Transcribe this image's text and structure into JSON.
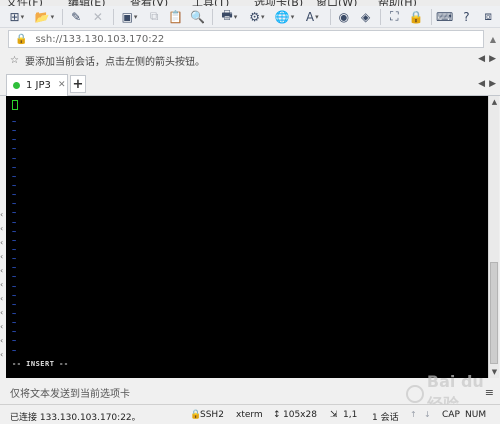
{
  "menubar": {
    "items": [
      "文件(F)",
      "编辑(E)",
      "查看(V)",
      "工具(T)",
      "选项卡(B)",
      "窗口(W)",
      "帮助(H)"
    ]
  },
  "toolbar": {
    "buttons": [
      {
        "icon": "new-session-icon",
        "glyph": "⊞",
        "dropdown": true
      },
      {
        "icon": "open-folder-icon",
        "glyph": "📂",
        "dropdown": true
      },
      {
        "icon": "link-icon",
        "glyph": "✎",
        "dropdown": false
      },
      {
        "icon": "disconnect-icon",
        "glyph": "✕",
        "dropdown": false,
        "disabled": true
      },
      {
        "icon": "new-window-icon",
        "glyph": "▣",
        "dropdown": true
      },
      {
        "icon": "copy-icon",
        "glyph": "⧉",
        "dropdown": false,
        "disabled": true
      },
      {
        "icon": "paste-icon",
        "glyph": "📋",
        "dropdown": false
      },
      {
        "icon": "find-icon",
        "glyph": "🔍",
        "dropdown": false
      },
      {
        "icon": "print-icon",
        "glyph": "🖶",
        "dropdown": true
      },
      {
        "icon": "properties-icon",
        "glyph": "⚙",
        "dropdown": true
      },
      {
        "icon": "globe-icon",
        "glyph": "🌐",
        "dropdown": true
      },
      {
        "icon": "font-icon",
        "glyph": "A",
        "dropdown": true
      },
      {
        "icon": "xshell-icon",
        "glyph": "◉",
        "dropdown": false
      },
      {
        "icon": "xftp-icon",
        "glyph": "◈",
        "dropdown": false
      },
      {
        "icon": "fullscreen-icon",
        "glyph": "⛶",
        "dropdown": false
      },
      {
        "icon": "lock-icon",
        "glyph": "🔒",
        "dropdown": false
      },
      {
        "icon": "keyboard-icon",
        "glyph": "⌨",
        "dropdown": false
      },
      {
        "icon": "help-icon",
        "glyph": "?",
        "dropdown": false
      },
      {
        "icon": "script-icon",
        "glyph": "⧈",
        "dropdown": false
      }
    ]
  },
  "address": {
    "url": "ssh://133.130.103.170:22"
  },
  "hint": {
    "text": "要添加当前会话，点击左侧的箭头按钮。"
  },
  "tabs": [
    {
      "label": "1 JP3",
      "status": "connected"
    }
  ],
  "terminal": {
    "tilde_count": 26,
    "tilde": "~",
    "mode": "-- INSERT --"
  },
  "sendbar": {
    "text": "仅将文本发送到当前选项卡"
  },
  "statusbar": {
    "connection": "已连接 133.130.103.170:22。",
    "protocol": "SSH2",
    "terminal_type": "xterm",
    "size": "105x28",
    "position": "1,1",
    "sessions": "1 会话",
    "cap": "CAP",
    "num": "NUM"
  },
  "watermark": {
    "text": "Bai du 经验"
  },
  "colors": {
    "terminal_bg": "#000000",
    "tilde": "#3a6bff",
    "cursor": "#2dd12d",
    "tab_status": "#2fbf3a"
  }
}
